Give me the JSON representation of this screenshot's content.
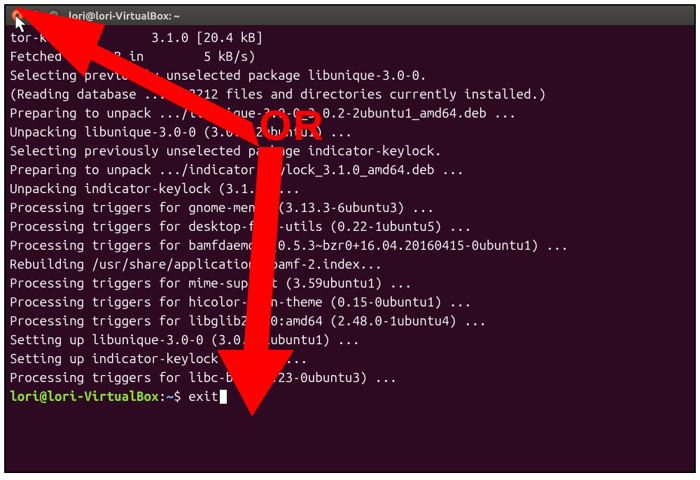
{
  "window": {
    "title": "lori@lori-VirtualBox: ~",
    "close_glyph": "×",
    "min_glyph": "–",
    "max_glyph": "▢"
  },
  "terminal": {
    "lines": [
      "tor-keylock        3.1.0 [20.4 kB]",
      "Fetched 42.7 kB in        5 kB/s)",
      "Selecting previously unselected package libunique-3.0-0.",
      "(Reading database ... 342212 files and directories currently installed.)",
      "Preparing to unpack .../libunique-3.0-0_3.0.2-2ubuntu1_amd64.deb ...",
      "Unpacking libunique-3.0-0 (3.0.2-2ubuntu1) ...",
      "Selecting previously unselected package indicator-keylock.",
      "Preparing to unpack .../indicator-keylock_3.1.0_amd64.deb ...",
      "Unpacking indicator-keylock (3.1.0) ...",
      "Processing triggers for gnome-menus (3.13.3-6ubuntu3) ...",
      "Processing triggers for desktop-file-utils (0.22-1ubuntu5) ...",
      "Processing triggers for bamfdaemon (0.5.3~bzr0+16.04.20160415-0ubuntu1) ...",
      "Rebuilding /usr/share/applications/bamf-2.index...",
      "Processing triggers for mime-support (3.59ubuntu1) ...",
      "Processing triggers for hicolor-icon-theme (0.15-0ubuntu1) ...",
      "Processing triggers for libglib2.0-0:amd64 (2.48.0-1ubuntu4) ...",
      "Setting up libunique-3.0-0 (3.0.2-2ubuntu1) ...",
      "Setting up indicator-keylock (3.1.0) ...",
      "Processing triggers for libc-bin (2.23-0ubuntu3) ..."
    ],
    "prompt_user": "lori@lori-VirtualBox",
    "prompt_sep": ":",
    "prompt_path": "~",
    "prompt_sym": "$",
    "command": "exit"
  },
  "annotation": {
    "label": "OR"
  }
}
